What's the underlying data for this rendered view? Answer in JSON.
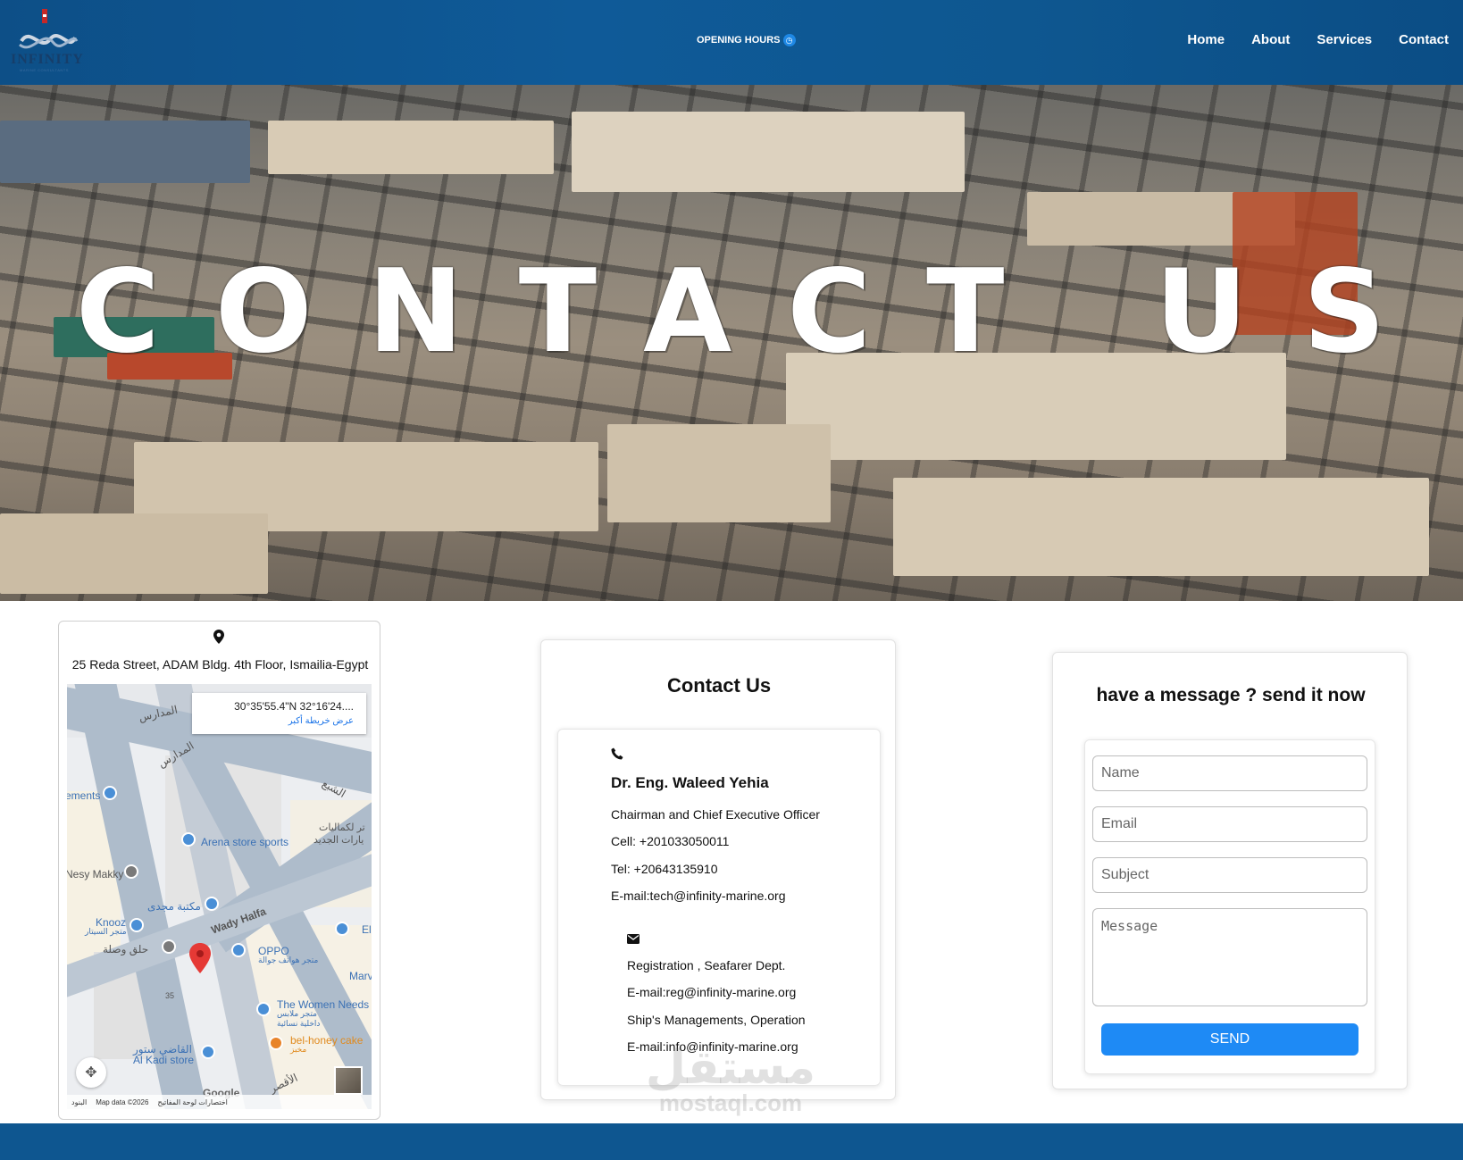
{
  "header": {
    "logo_text": "INFINITY",
    "logo_subtext": "MARINE CONSULTANTS",
    "opening_hours": "OPENING HOURS",
    "nav": [
      {
        "label": "Home"
      },
      {
        "label": "About"
      },
      {
        "label": "Services"
      },
      {
        "label": "Contact"
      }
    ]
  },
  "hero": {
    "title": "CONTACT US"
  },
  "location": {
    "address": "25 Reda Street, ADAM Bldg. 4th Floor, Ismailia-Egypt",
    "map": {
      "coords": "30°35'55.4\"N 32°16'24....",
      "view_larger": "عرض خريطة أكبر",
      "labels": {
        "l1": "المدارس",
        "l2": "المدارس",
        "l3": "ements",
        "l4": "Arena store sports",
        "l5": "Nesy Makky",
        "l6": "مكتبة مجدى",
        "l7": "Knooz",
        "l7s": "متجر السيتار",
        "l8": "حلق وصلة",
        "l9": "OPPO",
        "l9s": "متجر هواتف جوالة",
        "l10": "Wady Halfa",
        "l11": "The Women Needs",
        "l11s": "متجر ملابس داخلية نسائية",
        "l12": "bel-honey cake",
        "l12s": "مخبز",
        "l13": "القاضي ستور",
        "l14": "Al Kadi store",
        "l15": "تر لكماليات",
        "l15s": "يارات الجديد",
        "l16": "Marv",
        "l17": "El",
        "l18": "35",
        "l19": "الشبع",
        "l20": "الأقصر"
      },
      "google": "Google",
      "footer_keys": "اختصارات لوحة المفاتيح",
      "footer_data": "Map data ©2026",
      "footer_terms": "البنود"
    }
  },
  "contact": {
    "title": "Contact Us",
    "phone_icon": "phone-icon",
    "name": "Dr. Eng. Waleed Yehia",
    "role": "Chairman and Chief Executive Officer",
    "cell": "Cell: +201033050011",
    "tel": "Tel: +20643135910",
    "email1": "E-mail:tech@infinity-marine.org",
    "mail_icon": "envelope-icon",
    "dept1": "Registration , Seafarer Dept.",
    "email2": "E-mail:reg@infinity-marine.org",
    "dept2": "Ship's Managements, Operation",
    "email3": "E-mail:info@infinity-marine.org"
  },
  "form": {
    "title": "have a message ? send it now",
    "name_placeholder": "Name",
    "email_placeholder": "Email",
    "subject_placeholder": "Subject",
    "message_placeholder": "Message",
    "send_label": "SEND",
    "send_color": "#1e8af5"
  },
  "watermark": {
    "arabic": "مستقل",
    "latin": "mostaql.com"
  },
  "colors": {
    "header": "#0e5790",
    "footer": "#0e5690",
    "accent": "#1e8af5"
  }
}
